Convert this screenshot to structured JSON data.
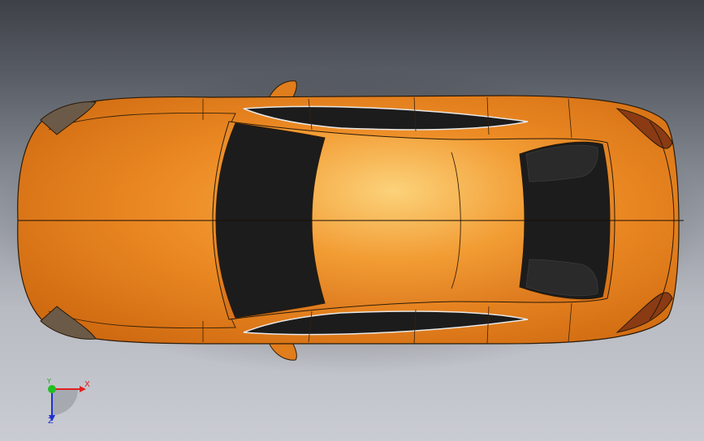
{
  "viewport": {
    "background_top": "#3e4147",
    "background_bottom": "#c9ccd2",
    "model": {
      "body_color": "#e8821e",
      "highlight_color": "#f9c060",
      "glass_color": "#1c1c1c",
      "edge_color": "#2a1a08"
    }
  },
  "triad": {
    "x_label": "X",
    "y_label": "Y",
    "z_label": "Z",
    "x_color": "#e02020",
    "y_color": "#20c020",
    "z_color": "#2030d0"
  }
}
